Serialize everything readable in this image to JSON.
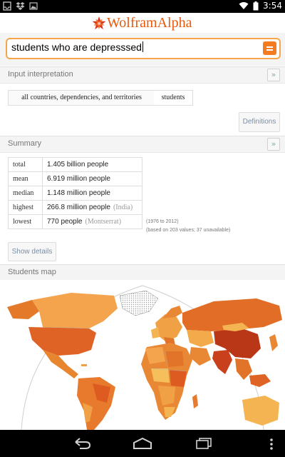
{
  "status_bar": {
    "time": "3:54"
  },
  "app": {
    "logo": "WolframAlpha"
  },
  "search": {
    "query": "students who are depresssed"
  },
  "input_interpretation": {
    "title": "Input interpretation",
    "terms": [
      "all countries, dependencies, and territories",
      "students"
    ],
    "definitions_button": "Definitions"
  },
  "summary": {
    "title": "Summary",
    "rows": [
      {
        "label": "total",
        "value": "1.405 billion people",
        "note": ""
      },
      {
        "label": "mean",
        "value": "6.919 million people",
        "note": ""
      },
      {
        "label": "median",
        "value": "1.148 million people",
        "note": ""
      },
      {
        "label": "highest",
        "value": "266.8 million people",
        "note": "(India)"
      },
      {
        "label": "lowest",
        "value": "770 people",
        "note": "(Montserrat)"
      }
    ],
    "range_note": "(1976 to 2012)",
    "values_note": "(based on 203 values; 37 unavailable)",
    "details_button": "Show details"
  },
  "students_map": {
    "title": "Students map"
  },
  "colors": {
    "accent": "#f47b20",
    "search_border": "#f5a54a"
  },
  "icons": [
    "notification-icon",
    "dropbox-icon",
    "image-icon",
    "wifi-icon",
    "battery-icon",
    "back-icon",
    "home-icon",
    "recents-icon",
    "menu-icon"
  ]
}
